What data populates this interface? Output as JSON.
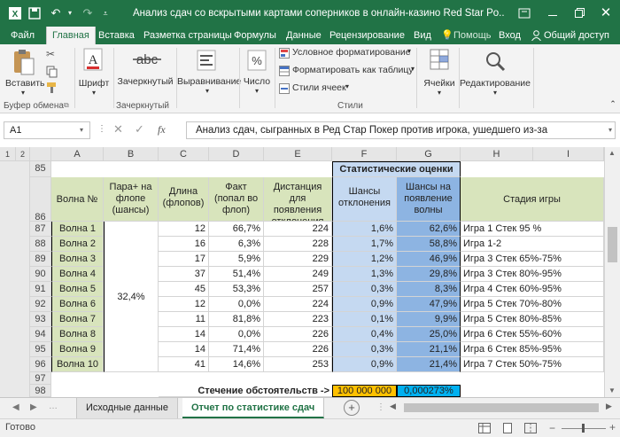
{
  "titlebar": {
    "title": "Анализ сдач со вскрытыми картами соперников в онлайн-казино Red Star Po...",
    "qat_icons": [
      "excel-logo",
      "save-icon",
      "undo-icon",
      "redo-icon",
      "customize-icon"
    ],
    "window_controls": [
      "ribbon-options",
      "minimize",
      "restore",
      "close"
    ]
  },
  "tabs": {
    "file": "Файл",
    "items": [
      "Главная",
      "Вставка",
      "Разметка страницы",
      "Формулы",
      "Данные",
      "Рецензирование",
      "Вид"
    ],
    "help": "Помощь",
    "signin": "Вход",
    "share": "Общий доступ"
  },
  "ribbon": {
    "paste": "Вставить",
    "clipboard": "Буфер обмена",
    "font": "Шрифт",
    "strike": "Зачеркнутый",
    "strike_group": "Зачеркнутый",
    "alignment": "Выравнивание",
    "number": "Число",
    "cond_format": "Условное форматирование",
    "format_table": "Форматировать как таблицу",
    "cell_styles": "Стили ячеек",
    "styles_group": "Стили",
    "cells": "Ячейки",
    "editing": "Редактирование"
  },
  "formula_bar": {
    "name_box": "A1",
    "fx_label": "fx",
    "content": "Анализ сдач, сыгранных в Ред Стар Покер против игрока, ушедшего из-за"
  },
  "grid": {
    "columns": [
      "A",
      "B",
      "C",
      "D",
      "E",
      "F",
      "G",
      "H",
      "I"
    ],
    "stat_header": "Статистические оценки",
    "headers": {
      "wave": "Волна №",
      "pair": "Пара+ на флопе (шансы)",
      "length": "Длина (флопов)",
      "fact": "Факт (попал во флоп)",
      "distance": "Дистанция для появления отклонения",
      "deviation": "Шансы отклонения",
      "chance": "Шансы на появление волны",
      "stage": "Стадия игры"
    },
    "merged_pair_value": "32,4%",
    "rows": [
      {
        "num": "87",
        "wave": "Волна 1",
        "len": "12",
        "fact": "66,7%",
        "dist": "224",
        "dev": "1,6%",
        "chance": "62,6%",
        "stage": "Игра 1 Стек 95 %"
      },
      {
        "num": "88",
        "wave": "Волна 2",
        "len": "16",
        "fact": "6,3%",
        "dist": "228",
        "dev": "1,7%",
        "chance": "58,8%",
        "stage": "Игра 1-2"
      },
      {
        "num": "89",
        "wave": "Волна 3",
        "len": "17",
        "fact": "5,9%",
        "dist": "229",
        "dev": "1,2%",
        "chance": "46,9%",
        "stage": "Игра 3 Стек 65%-75%"
      },
      {
        "num": "90",
        "wave": "Волна 4",
        "len": "37",
        "fact": "51,4%",
        "dist": "249",
        "dev": "1,3%",
        "chance": "29,8%",
        "stage": "Игра 3 Стек 80%-95%"
      },
      {
        "num": "91",
        "wave": "Волна 5",
        "len": "45",
        "fact": "53,3%",
        "dist": "257",
        "dev": "0,3%",
        "chance": "8,3%",
        "stage": "Игра 4 Стек 60%-95%"
      },
      {
        "num": "92",
        "wave": "Волна 6",
        "len": "12",
        "fact": "0,0%",
        "dist": "224",
        "dev": "0,9%",
        "chance": "47,9%",
        "stage": "Игра 5 Стек 70%-80%"
      },
      {
        "num": "93",
        "wave": "Волна 7",
        "len": "11",
        "fact": "81,8%",
        "dist": "223",
        "dev": "0,1%",
        "chance": "9,9%",
        "stage": "Игра 5 Стек 80%-85%"
      },
      {
        "num": "94",
        "wave": "Волна 8",
        "len": "14",
        "fact": "0,0%",
        "dist": "226",
        "dev": "0,4%",
        "chance": "25,0%",
        "stage": "Игра 6 Стек 55%-60%"
      },
      {
        "num": "95",
        "wave": "Волна 9",
        "len": "14",
        "fact": "71,4%",
        "dist": "226",
        "dev": "0,3%",
        "chance": "21,1%",
        "stage": "Игра 6 Стек 85%-95%"
      },
      {
        "num": "96",
        "wave": "Волна 10",
        "len": "41",
        "fact": "14,6%",
        "dist": "253",
        "dev": "0,9%",
        "chance": "21,4%",
        "stage": "Игра 7 Стек 50%-75%"
      }
    ],
    "row_numbers": {
      "r85": "85",
      "r86": "86",
      "r97": "97",
      "r98": "98"
    },
    "coincidence_label": "Стечение обстоятельств ->",
    "coincidence_value": "100 000 000",
    "coincidence_result": "0,000273%",
    "colors": {
      "stat_bg": "#c5d9f1",
      "chance_bg": "#8db4e2",
      "stage_bg": "#d8e4bc",
      "yellow": "#ffc000",
      "cyan": "#00b0f0"
    }
  },
  "sheets": {
    "tabs": [
      "Исходные данные",
      "Отчет по статистике сдач"
    ],
    "active": "Отчет по статистике сдач"
  },
  "status": {
    "ready": "Готово"
  }
}
